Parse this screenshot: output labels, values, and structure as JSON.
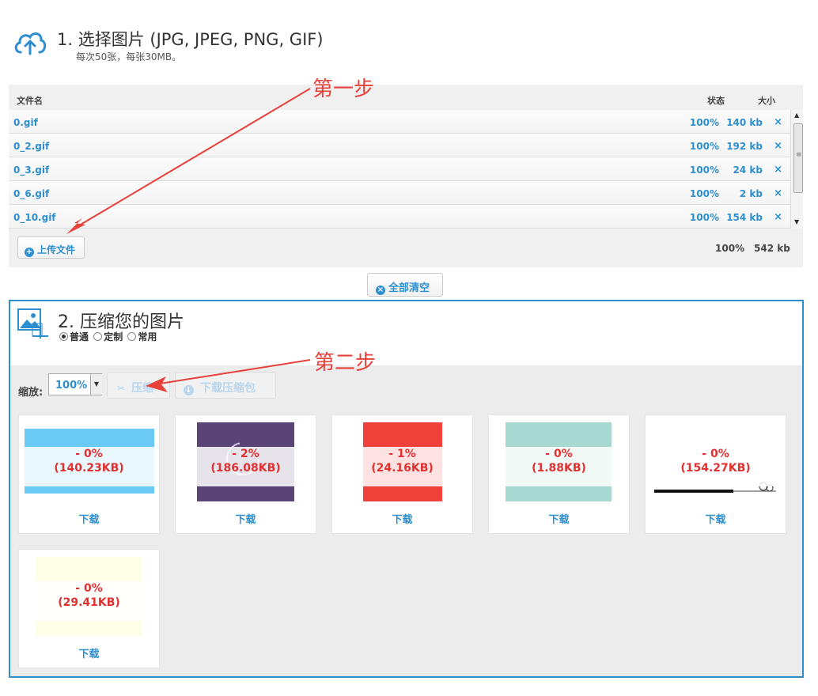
{
  "section1": {
    "title": "1. 选择图片 (JPG, JPEG, PNG, GIF)",
    "subtitle": "每次50张，每张30MB。",
    "icon": "cloud-upload-icon"
  },
  "file_table": {
    "headers": {
      "name": "文件名",
      "status": "状态",
      "size": "大小"
    },
    "rows": [
      {
        "name": "0.gif",
        "percent": "100%",
        "size": "140 kb"
      },
      {
        "name": "0_2.gif",
        "percent": "100%",
        "size": "192 kb"
      },
      {
        "name": "0_3.gif",
        "percent": "100%",
        "size": "24 kb"
      },
      {
        "name": "0_6.gif",
        "percent": "100%",
        "size": "2 kb"
      },
      {
        "name": "0_10.gif",
        "percent": "100%",
        "size": "154 kb"
      }
    ],
    "delete_glyph": "×",
    "total_percent": "100%",
    "total_size": "542 kb"
  },
  "upload_button": "上传文件",
  "clear_all_button": "全部清空",
  "annotations": {
    "step1": "第一步",
    "step2": "第二步",
    "color": "#e8403a"
  },
  "section2": {
    "title": "2. 压缩您的图片",
    "icon": "image-resize-icon",
    "modes": [
      {
        "label": "普通",
        "selected": true
      },
      {
        "label": "定制",
        "selected": false
      },
      {
        "label": "常用",
        "selected": false
      }
    ]
  },
  "toolbar": {
    "zoom_label": "缩放:",
    "zoom_value": "100%",
    "compress_button": "压缩",
    "download_zip_button": "下载压缩包"
  },
  "results": [
    {
      "percent": "- 0%",
      "size": "(140.23KB)",
      "download": "下载"
    },
    {
      "percent": "- 2%",
      "size": "(186.08KB)",
      "download": "下载"
    },
    {
      "percent": "- 1%",
      "size": "(24.16KB)",
      "download": "下载"
    },
    {
      "percent": "- 0%",
      "size": "(1.88KB)",
      "download": "下载"
    },
    {
      "percent": "- 0%",
      "size": "(154.27KB)",
      "download": "下载"
    },
    {
      "percent": "- 0%",
      "size": "(29.41KB)",
      "download": "下载"
    }
  ],
  "colors": {
    "accent": "#2e8fd0",
    "result_text": "#e03030",
    "panel_bg": "#f0f0f0"
  }
}
